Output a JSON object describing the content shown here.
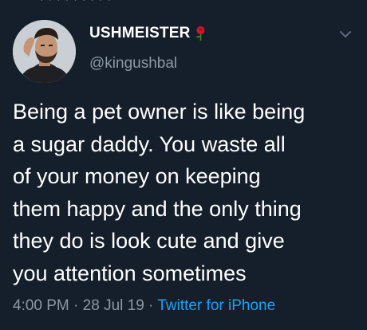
{
  "tweet": {
    "top_fragment": "· · · · · · · · ·",
    "author": {
      "display_name": "USHMEISTER",
      "handle": "@kingushbal",
      "name_emoji": "rose-icon",
      "avatar": "avatar"
    },
    "text_lines": [
      "Being a pet owner is like being",
      "a sugar daddy. You waste all",
      "of your money on keeping",
      "them happy and the only thing",
      "they do is look cute and give",
      "you attention sometimes"
    ],
    "meta": {
      "time": "4:00 PM",
      "separator": " · ",
      "date": "28 Jul 19",
      "source": "Twitter for iPhone"
    },
    "menu_icon": "chevron-down-icon"
  },
  "colors": {
    "background": "#151f2b",
    "text": "#ffffff",
    "secondary": "#8b98a5",
    "link": "#1da1f2",
    "rose": "#d0142c"
  }
}
